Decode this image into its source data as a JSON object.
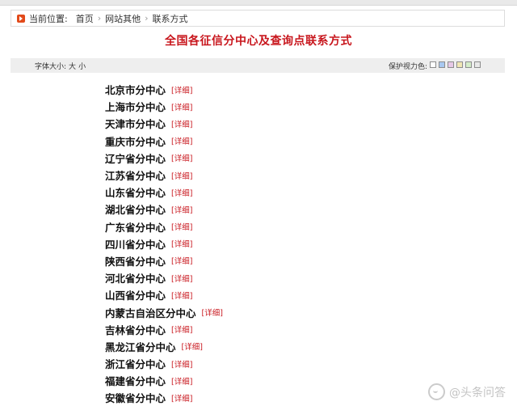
{
  "breadcrumb": {
    "label": "当前位置:",
    "items": [
      "首页",
      "网站其他",
      "联系方式"
    ]
  },
  "page_title": "全国各征信分中心及查询点联系方式",
  "toolbar": {
    "font_size_label": "字体大小:",
    "font_large": "大",
    "font_small": "小",
    "eye_label": "保护视力色:",
    "eye_colors": [
      "#ffffff",
      "#a8c8f0",
      "#e6c8e6",
      "#f0e6b4",
      "#d4ecc8",
      "#e8e8e8"
    ]
  },
  "detail_label": "[详细]",
  "centers": [
    "北京市分中心",
    "上海市分中心",
    "天津市分中心",
    "重庆市分中心",
    "辽宁省分中心",
    "江苏省分中心",
    "山东省分中心",
    "湖北省分中心",
    "广东省分中心",
    "四川省分中心",
    "陕西省分中心",
    "河北省分中心",
    "山西省分中心",
    "内蒙古自治区分中心",
    "吉林省分中心",
    "黑龙江省分中心",
    "浙江省分中心",
    "福建省分中心",
    "安徽省分中心"
  ],
  "watermark": "@头条问答",
  "colors": {
    "accent_red": "#c8161d",
    "icon_orange": "#e24a1a",
    "toolbar_bg": "#eeeeee"
  }
}
